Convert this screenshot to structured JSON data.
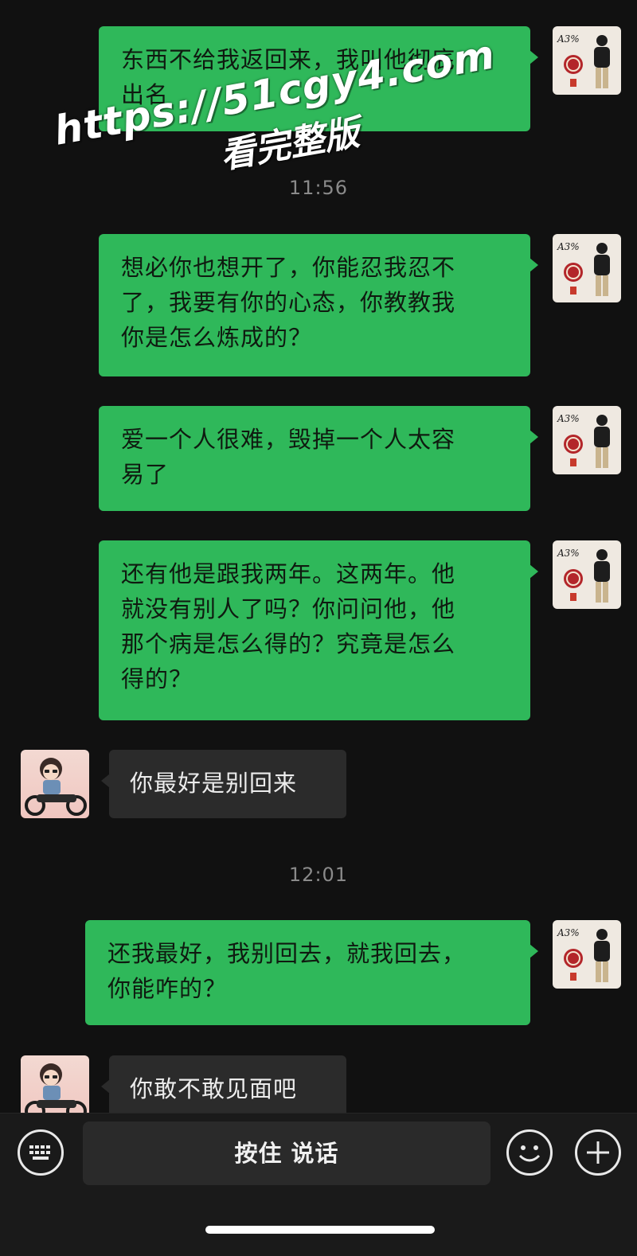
{
  "watermark": {
    "url": "https://51cgy4.com",
    "sub": "看完整版"
  },
  "messages": [
    {
      "side": "out",
      "lines": [
        "东西不给我返回来，我叫他彻底",
        "出名"
      ]
    },
    {
      "type": "time",
      "text": "11:56"
    },
    {
      "side": "out",
      "lines": [
        "想必你也想开了，你能忍我忍不",
        "了，我要有你的心态，你教教我",
        "你是怎么炼成的？"
      ]
    },
    {
      "side": "out",
      "lines": [
        "爱一个人很难，毁掉一个人太容",
        "易了"
      ]
    },
    {
      "side": "out",
      "lines": [
        "还有他是跟我两年。这两年。他",
        "就没有别人了吗？你问问他，他",
        "那个病是怎么得的？究竟是怎么",
        "得的？"
      ]
    },
    {
      "side": "in",
      "lines": [
        "你最好是别回来"
      ]
    },
    {
      "type": "time",
      "text": "12:01"
    },
    {
      "side": "out",
      "lines": [
        "还我最好，我别回去，就我回去，",
        "你能咋的？"
      ]
    },
    {
      "side": "in",
      "lines": [
        "你敢不敢见面吧"
      ]
    }
  ],
  "input_bar": {
    "keyboard_icon": "keyboard-icon",
    "hold_to_talk_label": "按住 说话",
    "emoji_icon": "smiley-icon",
    "add_icon": "plus-icon"
  },
  "colors": {
    "background": "#111111",
    "outgoing_bubble": "#2fb85a",
    "incoming_bubble": "#2b2b2b",
    "timestamp": "#8a8a8a"
  }
}
